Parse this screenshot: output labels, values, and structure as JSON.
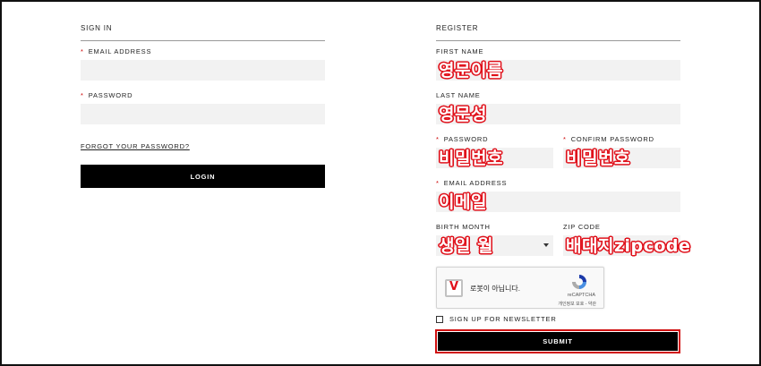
{
  "signin": {
    "title": "SIGN IN",
    "email_label": "EMAIL ADDRESS",
    "email_value": "",
    "password_label": "PASSWORD",
    "password_value": "",
    "forgot_link": "FORGOT YOUR PASSWORD?",
    "login_button": "LOGIN",
    "required_mark": "*"
  },
  "register": {
    "title": "REGISTER",
    "first_name_label": "FIRST NAME",
    "first_name_note": "영문이름",
    "last_name_label": "LAST NAME",
    "last_name_note": "영문성",
    "password_label": "PASSWORD",
    "password_note": "비밀번호",
    "confirm_password_label": "CONFIRM PASSWORD",
    "confirm_password_note": "비밀번호",
    "email_label": "EMAIL ADDRESS",
    "email_note": "이메일",
    "birth_month_label": "BIRTH MONTH",
    "birth_month_note": "생일 월",
    "zip_label": "ZIP CODE",
    "zip_note": "배대지zipcode",
    "newsletter_label": "SIGN UP FOR NEWSLETTER",
    "submit_button": "SUBMIT",
    "required_mark": "*"
  },
  "recaptcha": {
    "checkbox_mark": "V",
    "text": "로봇이 아닙니다.",
    "brand": "reCAPTCHA",
    "terms": "개인정보 보호 - 약관"
  },
  "colors": {
    "annotation_red": "#e0101a",
    "button_black": "#000000",
    "input_gray": "#f2f2f2"
  }
}
